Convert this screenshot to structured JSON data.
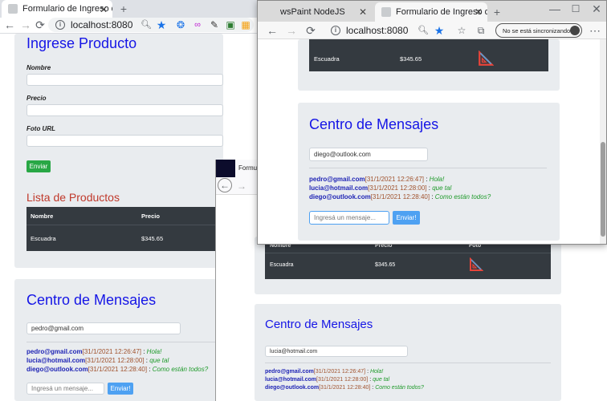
{
  "back_window": {
    "tab_title": "Formulario de Ingreso de Produc",
    "url": "localhost:8080",
    "form": {
      "title": "Ingrese Producto",
      "name_label": "Nombre",
      "price_label": "Precio",
      "photo_label": "Foto URL",
      "submit": "Enviar"
    },
    "list_title": "Lista de Productos",
    "table": {
      "headers": [
        "Nombre",
        "Precio"
      ],
      "row": [
        "Escuadra",
        "$345.65"
      ]
    },
    "chat": {
      "title": "Centro de Mensajes",
      "email": "pedro@gmail.com",
      "messages": [
        {
          "email": "pedro@gmail.com",
          "date": "[31/1/2021 12:26:47]",
          "sep": " : ",
          "text": "Hola!"
        },
        {
          "email": "lucia@hotmail.com",
          "date": "[31/1/2021 12:28:00]",
          "sep": " : ",
          "text": "que tal"
        },
        {
          "email": "diego@outlook.com",
          "date": "[31/1/2021 12:28:40]",
          "sep": " : ",
          "text": "Como están todos?"
        }
      ],
      "placeholder": "Ingresá un mensaje...",
      "send": "Enviar!"
    }
  },
  "middle_window": {
    "tab_title": "Formul",
    "table": {
      "headers": [
        "Nombre",
        "Precio",
        "Foto"
      ],
      "row": [
        "Escuadra",
        "$345.65"
      ]
    },
    "chat": {
      "title": "Centro de Mensajes",
      "email": "lucia@hotmail.com",
      "messages": [
        {
          "email": "pedro@gmail.com",
          "date": "[31/1/2021 12:26:47]",
          "sep": " : ",
          "text": "Hola!"
        },
        {
          "email": "lucia@hotmail.com",
          "date": "[31/1/2021 12:28:00]",
          "sep": " : ",
          "text": "que tal"
        },
        {
          "email": "diego@outlook.com",
          "date": "[31/1/2021 12:28:40]",
          "sep": " : ",
          "text": "Como están todos?"
        }
      ]
    }
  },
  "front_window": {
    "tabs": [
      "wsPaint NodeJS",
      "Formulario de Ingreso de Produ"
    ],
    "url": "localhost:8080",
    "sync_label": "No se está sincronizando",
    "table": {
      "row": [
        "Escuadra",
        "$345.65"
      ]
    },
    "chat": {
      "title": "Centro de Mensajes",
      "email": "diego@outlook.com",
      "messages": [
        {
          "email": "pedro@gmail.com",
          "date": "[31/1/2021 12:26:47]",
          "sep": " : ",
          "text": "Hola!"
        },
        {
          "email": "lucia@hotmail.com",
          "date": "[31/1/2021 12:28:00]",
          "sep": " : ",
          "text": "que tal"
        },
        {
          "email": "diego@outlook.com",
          "date": "[31/1/2021 12:28:40]",
          "sep": " : ",
          "text": "Como están todos?"
        }
      ],
      "placeholder": "Ingresá un mensaje...",
      "send": "Enviar!"
    }
  }
}
